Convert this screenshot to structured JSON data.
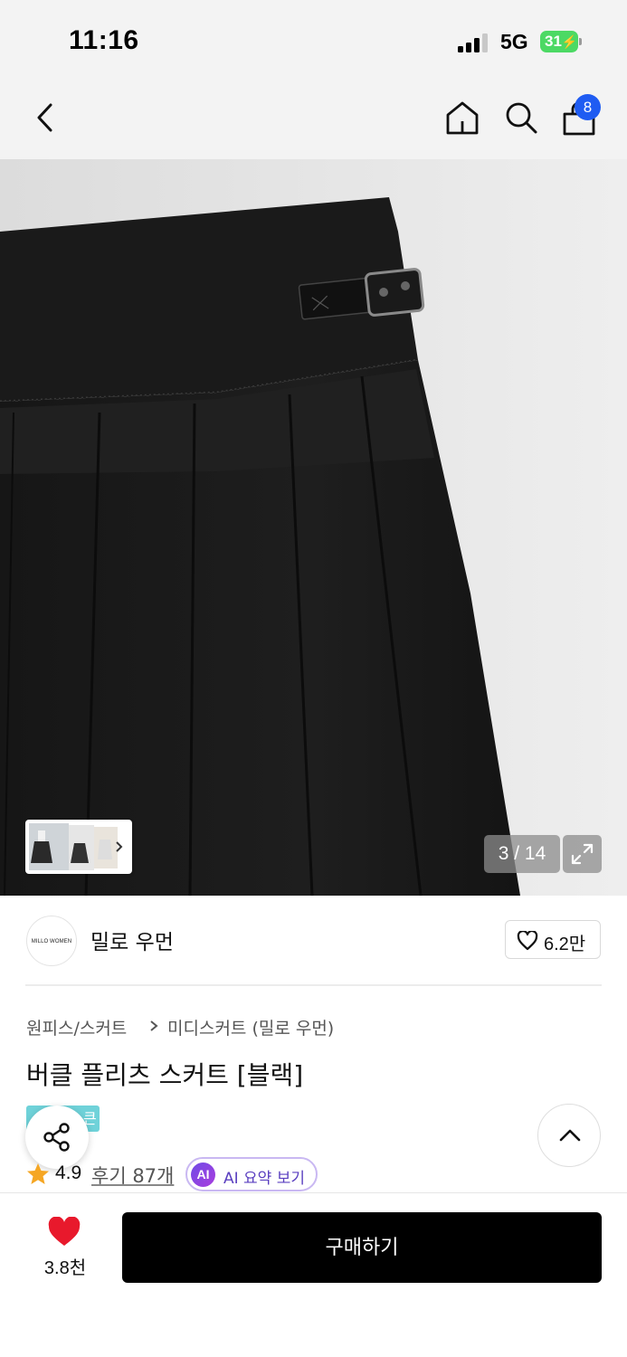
{
  "status_bar": {
    "time": "11:16",
    "network": "5G",
    "battery": "31"
  },
  "nav": {
    "cart_count": "8"
  },
  "gallery": {
    "counter": "3 / 14"
  },
  "brand": {
    "logo_text": "MILLO WOMEN",
    "name": "밀로 우먼",
    "likes": "6.2만"
  },
  "product": {
    "breadcrumb": [
      "원피스/스커트",
      "미디스커트 (밀로 우먼)"
    ],
    "title": "버클 플리츠 스커트 [블랙]",
    "tag_visible": "큰",
    "rating": "4.9",
    "reviews": "후기 87개",
    "ai_badge": "AI",
    "ai_summary": "AI 요약 보기"
  },
  "bottom": {
    "like_count": "3.8천",
    "buy_label": "구매하기"
  },
  "colors": {
    "accent_badge": "#1f5cf2",
    "heart": "#e8192c",
    "buy_button": "#000000",
    "ai_purple": "#6f4be6",
    "tag_teal": "#6fd2d9",
    "star": "#f5a623"
  }
}
